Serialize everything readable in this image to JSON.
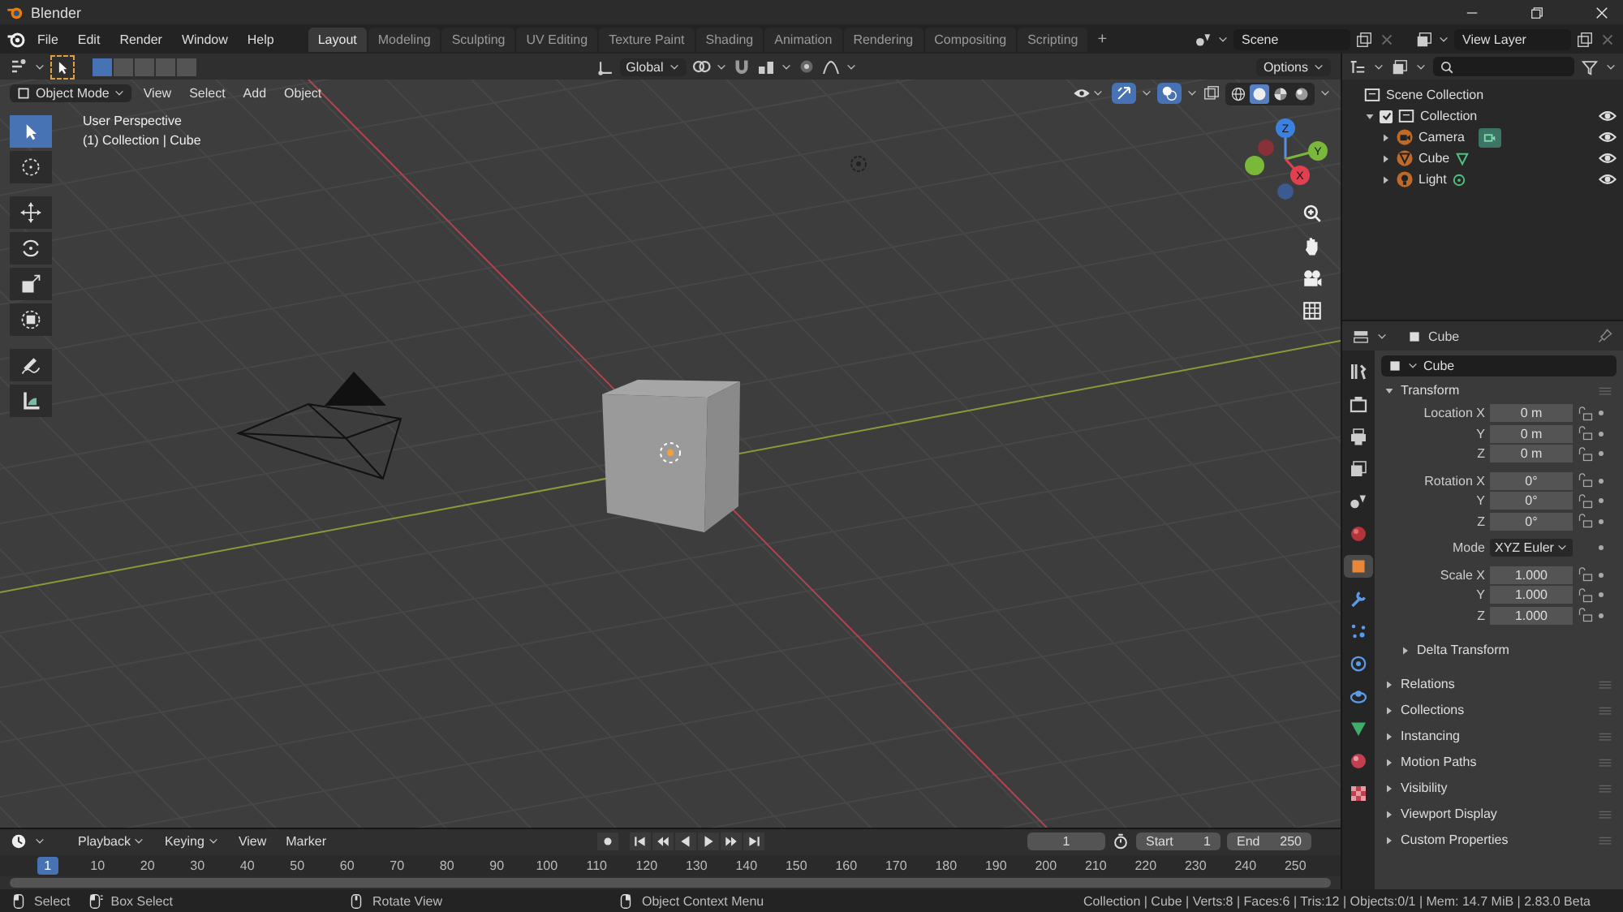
{
  "window": {
    "title": "Blender"
  },
  "menu": [
    "File",
    "Edit",
    "Render",
    "Window",
    "Help"
  ],
  "workspaces": [
    {
      "label": "Layout",
      "selected": true
    },
    {
      "label": "Modeling",
      "selected": false
    },
    {
      "label": "Sculpting",
      "selected": false
    },
    {
      "label": "UV Editing",
      "selected": false
    },
    {
      "label": "Texture Paint",
      "selected": false
    },
    {
      "label": "Shading",
      "selected": false
    },
    {
      "label": "Animation",
      "selected": false
    },
    {
      "label": "Rendering",
      "selected": false
    },
    {
      "label": "Compositing",
      "selected": false
    },
    {
      "label": "Scripting",
      "selected": false
    }
  ],
  "add_workspace": "+",
  "scene": "Scene",
  "view_layer": "View Layer",
  "viewport": {
    "select_modes": [
      {
        "selected": true
      },
      {
        "selected": false
      },
      {
        "selected": false
      },
      {
        "selected": false
      },
      {
        "selected": false
      }
    ],
    "orientation": "Global",
    "options": "Options",
    "mode": "Object Mode",
    "menus": [
      "View",
      "Select",
      "Add",
      "Object"
    ],
    "shading": [
      {
        "kind": "wireframe",
        "selected": false
      },
      {
        "kind": "solid",
        "selected": true
      },
      {
        "kind": "material",
        "selected": false
      },
      {
        "kind": "rendered",
        "selected": false
      }
    ],
    "overlay_lines": [
      "User Perspective",
      "(1) Collection | Cube"
    ],
    "tools": [
      {
        "kind": "select",
        "selected": true
      },
      {
        "kind": "cursor",
        "selected": false
      },
      {
        "kind": "move",
        "selected": false
      },
      {
        "kind": "rotate",
        "selected": false
      },
      {
        "kind": "scale",
        "selected": false
      },
      {
        "kind": "transform",
        "selected": false
      },
      {
        "kind": "annotate",
        "selected": false
      },
      {
        "kind": "measure",
        "selected": false
      }
    ],
    "gizmo": {
      "x": "X",
      "y": "Y",
      "z": "Z"
    }
  },
  "outliner": {
    "items": [
      {
        "label": "Scene Collection",
        "kind": "scene_collection",
        "children": [
          {
            "label": "Collection",
            "kind": "collection",
            "checked": true,
            "expanded": true,
            "visible": true,
            "children": [
              {
                "label": "Camera",
                "kind": "camera",
                "expanded": false,
                "visible": true
              },
              {
                "label": "Cube",
                "kind": "mesh",
                "expanded": false,
                "visible": true
              },
              {
                "label": "Light",
                "kind": "light",
                "expanded": false,
                "visible": true
              }
            ]
          }
        ]
      }
    ]
  },
  "properties": {
    "object": "Cube",
    "name_field": "Cube",
    "tabs": [
      {
        "kind": "tool",
        "selected": false
      },
      {
        "kind": "render",
        "selected": false
      },
      {
        "kind": "output",
        "selected": false
      },
      {
        "kind": "view_layer",
        "selected": false
      },
      {
        "kind": "scene",
        "selected": false
      },
      {
        "kind": "world",
        "selected": false
      },
      {
        "kind": "object",
        "selected": true
      },
      {
        "kind": "modifier",
        "selected": false
      },
      {
        "kind": "particles",
        "selected": false
      },
      {
        "kind": "physics",
        "selected": false
      },
      {
        "kind": "constraints",
        "selected": false
      },
      {
        "kind": "data",
        "selected": false
      },
      {
        "kind": "material",
        "selected": false
      },
      {
        "kind": "texture",
        "selected": false
      }
    ],
    "transform": {
      "label": "Transform",
      "expanded": true,
      "groups": [
        [
          {
            "label": "Location X",
            "value": "0 m",
            "kind": "number"
          },
          {
            "label": "Y",
            "value": "0 m",
            "kind": "number"
          },
          {
            "label": "Z",
            "value": "0 m",
            "kind": "number"
          }
        ],
        [
          {
            "label": "Rotation X",
            "value": "0°",
            "kind": "number"
          },
          {
            "label": "Y",
            "value": "0°",
            "kind": "number"
          },
          {
            "label": "Z",
            "value": "0°",
            "kind": "number"
          }
        ],
        [
          {
            "label": "Mode",
            "value": "XYZ Euler",
            "kind": "dropdown"
          }
        ],
        [
          {
            "label": "Scale X",
            "value": "1.000",
            "kind": "number"
          },
          {
            "label": "Y",
            "value": "1.000",
            "kind": "number"
          },
          {
            "label": "Z",
            "value": "1.000",
            "kind": "number"
          }
        ]
      ],
      "subpanel": {
        "label": "Delta Transform",
        "expanded": false
      }
    },
    "panels": [
      {
        "label": "Relations",
        "expanded": false
      },
      {
        "label": "Collections",
        "expanded": false
      },
      {
        "label": "Instancing",
        "expanded": false
      },
      {
        "label": "Motion Paths",
        "expanded": false
      },
      {
        "label": "Visibility",
        "expanded": false
      },
      {
        "label": "Viewport Display",
        "expanded": false
      },
      {
        "label": "Custom Properties",
        "expanded": false
      }
    ]
  },
  "timeline": {
    "menus": [
      {
        "label": "Playback",
        "dropdown": true
      },
      {
        "label": "Keying",
        "dropdown": true
      },
      {
        "label": "View",
        "dropdown": false
      },
      {
        "label": "Marker",
        "dropdown": false
      }
    ],
    "current_frame": "1",
    "start_label": "Start",
    "start": "1",
    "end_label": "End",
    "end": "250",
    "ticks": [
      {
        "label": "1",
        "selected": true
      },
      {
        "label": "10",
        "selected": false
      },
      {
        "label": "20",
        "selected": false
      },
      {
        "label": "30",
        "selected": false
      },
      {
        "label": "40",
        "selected": false
      },
      {
        "label": "50",
        "selected": false
      },
      {
        "label": "60",
        "selected": false
      },
      {
        "label": "70",
        "selected": false
      },
      {
        "label": "80",
        "selected": false
      },
      {
        "label": "90",
        "selected": false
      },
      {
        "label": "100",
        "selected": false
      },
      {
        "label": "110",
        "selected": false
      },
      {
        "label": "120",
        "selected": false
      },
      {
        "label": "130",
        "selected": false
      },
      {
        "label": "140",
        "selected": false
      },
      {
        "label": "150",
        "selected": false
      },
      {
        "label": "160",
        "selected": false
      },
      {
        "label": "170",
        "selected": false
      },
      {
        "label": "180",
        "selected": false
      },
      {
        "label": "190",
        "selected": false
      },
      {
        "label": "200",
        "selected": false
      },
      {
        "label": "210",
        "selected": false
      },
      {
        "label": "220",
        "selected": false
      },
      {
        "label": "230",
        "selected": false
      },
      {
        "label": "240",
        "selected": false
      },
      {
        "label": "250",
        "selected": false
      }
    ]
  },
  "status_bar": {
    "hints": [
      {
        "kind": "left",
        "label": "Select"
      },
      {
        "kind": "left_drag",
        "label": "Box Select"
      },
      {
        "kind": "middle",
        "label": "Rotate View"
      },
      {
        "kind": "right",
        "label": "Object Context Menu"
      }
    ],
    "stats": "Collection | Cube | Verts:8 | Faces:6 | Tris:12 | Objects:0/1 | Mem: 14.7 MiB | 2.83.0 Beta"
  }
}
